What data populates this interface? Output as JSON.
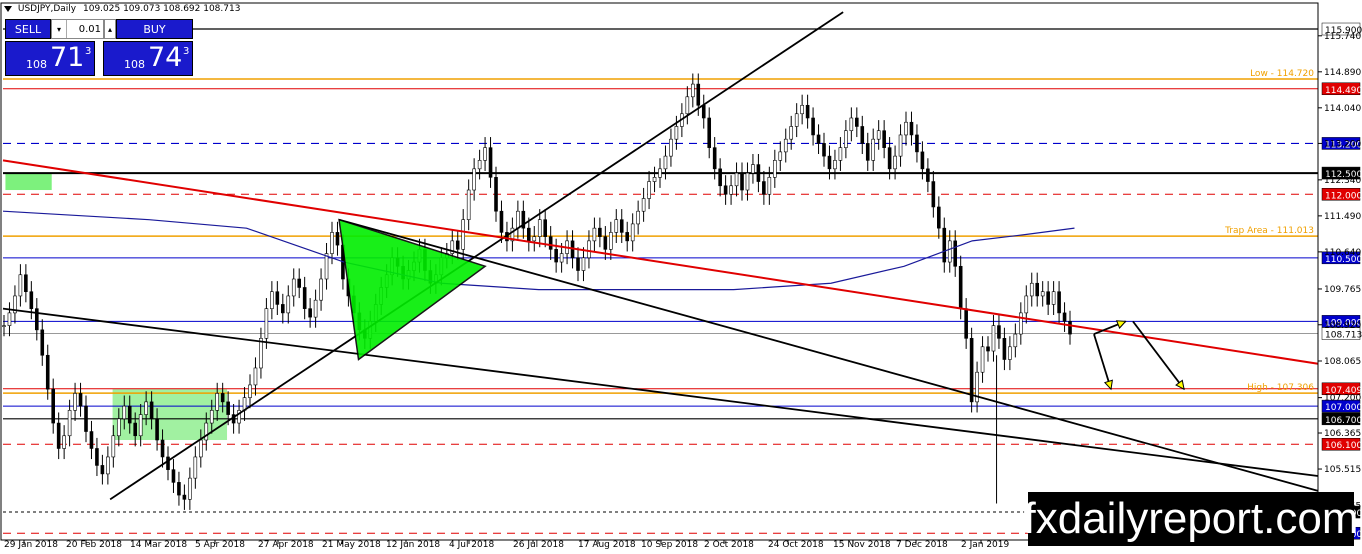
{
  "header": {
    "symbol": "USDJPY,Daily",
    "ohlc": "109.025 109.073 108.692 108.713"
  },
  "trade_panel": {
    "sell_label": "SELL",
    "buy_label": "BUY",
    "lot_value": "0.01",
    "bid_small": "108",
    "bid_big": "71",
    "bid_sup": "3",
    "ask_small": "108",
    "ask_big": "74",
    "ask_sup": "3"
  },
  "brand": "fxdailyreport.com",
  "colors": {
    "up": "#000000",
    "red_line": "#e00000",
    "orange": "#f0a000",
    "blue": "#0000cc",
    "navy_ma": "#1a1a9a",
    "green": "#00ee00",
    "light_green": "#90ee90"
  },
  "chart_data": {
    "type": "candlestick",
    "ylim": [
      103.84,
      116.16
    ],
    "y_ticks": [
      "115.740",
      "114.890",
      "114.040",
      "113.200",
      "112.340",
      "111.490",
      "110.640",
      "109.765",
      "108.920",
      "108.065",
      "107.200",
      "106.365",
      "105.515",
      "104.655"
    ],
    "x_ticks": [
      "29 Jan 2018",
      "20 Feb 2018",
      "14 Mar 2018",
      "5 Apr 2018",
      "27 Apr 2018",
      "21 May 2018",
      "12 Jun 2018",
      "4 Jul 2018",
      "26 Jul 2018",
      "17 Aug 2018",
      "10 Sep 2018",
      "2 Oct 2018",
      "24 Oct 2018",
      "15 Nov 2018",
      "7 Dec 2018",
      "2 Jan 2019"
    ],
    "price_levels": [
      {
        "value": 115.9,
        "label": "115.900",
        "style": "black-solid",
        "box": "white"
      },
      {
        "value": 114.49,
        "label": "114.490",
        "style": "red-solid",
        "box": "red"
      },
      {
        "value": 113.2,
        "label": "113.200",
        "style": "blue-dash",
        "box": "blue"
      },
      {
        "value": 112.5,
        "label": "112.500",
        "style": "black-solid-thick",
        "box": "black"
      },
      {
        "value": 112.0,
        "label": "112.000",
        "style": "red-dash",
        "box": "red"
      },
      {
        "value": 110.5,
        "label": "110.500",
        "style": "blue-solid",
        "box": "blue"
      },
      {
        "value": 109.0,
        "label": "109.000",
        "style": "blue-solid",
        "box": "blue"
      },
      {
        "value": 108.713,
        "label": "108.713",
        "style": "gray-solid",
        "box": "white"
      },
      {
        "value": 107.409,
        "label": "107.409",
        "style": "red-solid",
        "box": "red"
      },
      {
        "value": 107.0,
        "label": "107.000",
        "style": "blue-solid",
        "box": "blue"
      },
      {
        "value": 106.7,
        "label": "106.700",
        "style": "black-solid",
        "box": "black"
      },
      {
        "value": 106.1,
        "label": "106.100",
        "style": "red-dash",
        "box": "red"
      },
      {
        "value": 104.5,
        "label": "104.500",
        "style": "black-dash",
        "box": "black"
      },
      {
        "value": 104.0,
        "label": "104.000",
        "style": "red-dash",
        "box": "blue"
      }
    ],
    "orange_levels": [
      {
        "value": 114.72,
        "label": "Low - 114.720"
      },
      {
        "value": 111.013,
        "label": "Trap Area - 111.013"
      },
      {
        "value": 107.306,
        "label": "High - 107.306"
      }
    ],
    "closes": [
      108.9,
      109.2,
      109.6,
      110.1,
      109.7,
      109.3,
      108.8,
      108.2,
      107.4,
      106.6,
      106.0,
      106.3,
      106.9,
      107.3,
      107.0,
      106.4,
      106.0,
      105.6,
      105.4,
      105.8,
      106.3,
      106.7,
      107.0,
      106.6,
      106.3,
      106.8,
      107.1,
      106.7,
      106.2,
      105.8,
      105.5,
      105.2,
      104.9,
      104.8,
      105.3,
      105.8,
      106.2,
      106.6,
      106.9,
      107.3,
      107.1,
      106.8,
      106.6,
      106.9,
      107.2,
      107.5,
      107.9,
      108.6,
      109.3,
      109.7,
      109.4,
      109.2,
      109.6,
      110.0,
      109.8,
      109.3,
      109.1,
      109.5,
      110.0,
      110.6,
      111.1,
      110.8,
      110.0,
      109.6,
      109.2,
      108.8,
      108.6,
      109.0,
      109.4,
      109.8,
      110.1,
      110.5,
      110.3,
      110.0,
      110.2,
      110.4,
      110.7,
      110.2,
      109.9,
      110.1,
      110.5,
      110.6,
      110.9,
      110.7,
      111.4,
      112.1,
      112.6,
      112.8,
      113.1,
      112.4,
      111.6,
      111.1,
      110.9,
      111.2,
      111.6,
      111.2,
      110.9,
      111.0,
      111.4,
      111.0,
      110.7,
      110.4,
      110.6,
      110.9,
      110.5,
      110.2,
      110.5,
      110.9,
      111.2,
      111.0,
      110.7,
      111.1,
      111.4,
      111.1,
      110.9,
      111.3,
      111.6,
      111.9,
      112.3,
      112.4,
      112.6,
      112.9,
      113.3,
      113.6,
      113.9,
      114.3,
      114.6,
      114.1,
      113.8,
      113.1,
      112.6,
      112.2,
      112.0,
      112.2,
      112.5,
      112.1,
      112.5,
      112.7,
      112.3,
      112.0,
      112.4,
      112.8,
      113.0,
      113.3,
      113.6,
      113.9,
      114.1,
      113.8,
      113.4,
      113.2,
      112.9,
      112.6,
      112.8,
      113.1,
      113.5,
      113.8,
      113.6,
      113.2,
      112.8,
      113.3,
      113.5,
      113.1,
      112.6,
      112.9,
      113.4,
      113.7,
      113.4,
      113.0,
      112.6,
      112.3,
      111.7,
      111.2,
      110.4,
      110.9,
      110.3,
      109.3,
      108.6,
      107.1,
      107.8,
      108.4,
      108.3,
      108.9,
      108.6,
      108.1,
      108.4,
      108.7,
      109.2,
      109.6,
      109.9,
      109.6,
      109.7,
      109.4,
      109.7,
      109.2,
      109.0,
      108.7
    ],
    "moving_average": [
      [
        0,
        111.6
      ],
      [
        60,
        111.4
      ],
      [
        100,
        111.2
      ],
      [
        140,
        110.4
      ],
      [
        180,
        109.9
      ],
      [
        220,
        109.75
      ],
      [
        300,
        109.75
      ],
      [
        340,
        109.9
      ],
      [
        370,
        110.3
      ],
      [
        398,
        110.9
      ],
      [
        420,
        111.05
      ],
      [
        440,
        111.2
      ]
    ],
    "annotations": [
      {
        "type": "line",
        "color": "black",
        "from": [
          44,
          104.8
        ],
        "to": [
          345,
          116.3
        ]
      },
      {
        "type": "line",
        "color": "black",
        "from": [
          0,
          109.3
        ],
        "to": [
          540,
          105.35
        ]
      },
      {
        "type": "line",
        "color": "black",
        "from": [
          138,
          111.4
        ],
        "to": [
          540,
          105.0
        ]
      },
      {
        "type": "line",
        "color": "red",
        "from": [
          0,
          112.8
        ],
        "to": [
          540,
          108.0
        ]
      },
      {
        "type": "triangle",
        "color": "green",
        "points": [
          [
            138,
            111.4
          ],
          [
            198,
            110.3
          ],
          [
            146,
            108.1
          ]
        ]
      },
      {
        "type": "zone",
        "color": "light_green",
        "from": [
          45,
          107.4
        ],
        "to": [
          92,
          106.2
        ]
      },
      {
        "type": "zone",
        "color": "green_top",
        "from": [
          1,
          112.5
        ],
        "to": [
          20,
          112.1
        ]
      },
      {
        "type": "spike",
        "x": 408,
        "low": 104.7,
        "high": 108.2
      },
      {
        "type": "arrow",
        "from": [
          448,
          108.7
        ],
        "to": [
          455,
          107.4
        ]
      },
      {
        "type": "arrow",
        "from": [
          448,
          108.7
        ],
        "to": [
          461,
          109.0
        ]
      },
      {
        "type": "arrow",
        "from": [
          464,
          109.0
        ],
        "to": [
          485,
          107.4
        ]
      }
    ]
  }
}
